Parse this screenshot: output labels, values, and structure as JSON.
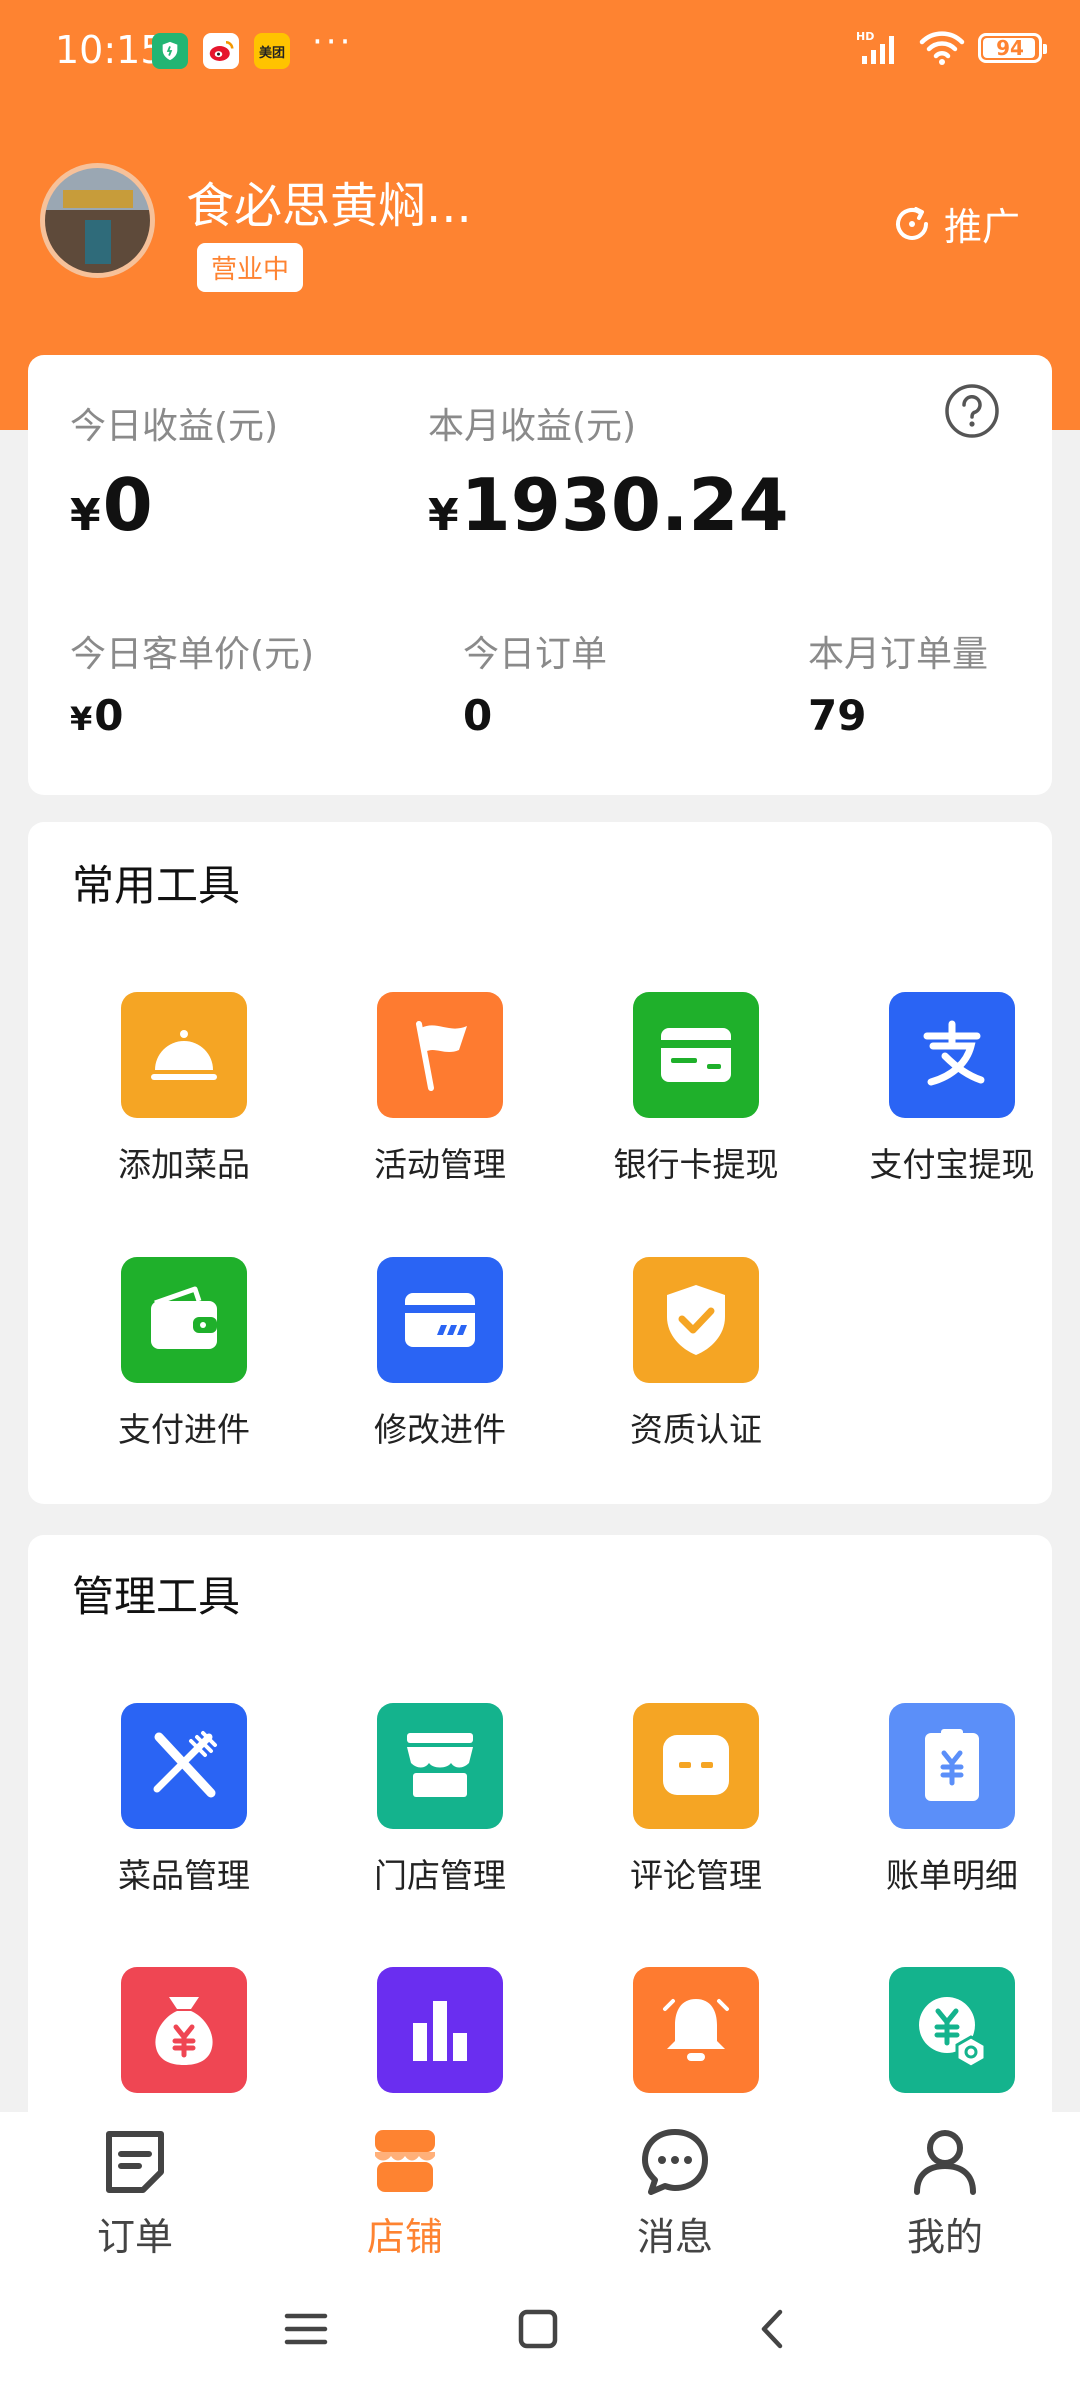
{
  "status_bar": {
    "time": "10:15",
    "app_icons": [
      {
        "name": "shield-app-icon",
        "text": "",
        "color": "#22b573"
      },
      {
        "name": "weibo-app-icon",
        "text": "",
        "color": "#e6162d"
      },
      {
        "name": "meituan-app-icon",
        "text": "美团",
        "color": "#ffc300"
      }
    ],
    "dots": "···",
    "battery": "94"
  },
  "header": {
    "shop_name": "食必思黄焖...",
    "status_badge": "营业中",
    "promo_label": "推广"
  },
  "earnings": {
    "today_label": "今日收益(元)",
    "today_currency": "¥",
    "today_value": "0",
    "month_label": "本月收益(元)",
    "month_currency": "¥",
    "month_value": "1930.24",
    "avg_label": "今日客单价(元)",
    "avg_currency": "¥",
    "avg_value": "0",
    "orders_today_label": "今日订单",
    "orders_today_value": "0",
    "orders_month_label": "本月订单量",
    "orders_month_value": "79"
  },
  "common_tools": {
    "title": "常用工具",
    "items": [
      {
        "label": "添加菜品",
        "icon": "dish-cover-icon",
        "color": "#f5a524"
      },
      {
        "label": "活动管理",
        "icon": "flag-icon",
        "color": "#fe7b30"
      },
      {
        "label": "银行卡提现",
        "icon": "bank-card-icon",
        "color": "#1fb02b"
      },
      {
        "label": "支付宝提现",
        "icon": "alipay-icon",
        "color": "#2a64f4"
      },
      {
        "label": "支付进件",
        "icon": "wallet-icon",
        "color": "#1fb02b"
      },
      {
        "label": "修改进件",
        "icon": "card-edit-icon",
        "color": "#2a64f4"
      },
      {
        "label": "资质认证",
        "icon": "shield-check-icon",
        "color": "#f5a524"
      }
    ]
  },
  "management_tools": {
    "title": "管理工具",
    "items": [
      {
        "label": "菜品管理",
        "icon": "fork-knife-icon",
        "color": "#2a64f4"
      },
      {
        "label": "门店管理",
        "icon": "storefront-icon",
        "color": "#14b38d"
      },
      {
        "label": "评论管理",
        "icon": "comment-icon",
        "color": "#f5a524"
      },
      {
        "label": "账单明细",
        "icon": "bill-icon",
        "color": "#5b8ff9"
      },
      {
        "label": "",
        "icon": "money-bag-icon",
        "color": "#ef4653"
      },
      {
        "label": "",
        "icon": "bar-chart-icon",
        "color": "#6a2ef0"
      },
      {
        "label": "",
        "icon": "bell-icon",
        "color": "#fe7b30"
      },
      {
        "label": "",
        "icon": "yen-badge-icon",
        "color": "#14b38d"
      }
    ]
  },
  "bottom_nav": [
    {
      "label": "订单",
      "icon": "order-icon",
      "active": false
    },
    {
      "label": "店铺",
      "icon": "shop-icon",
      "active": true
    },
    {
      "label": "消息",
      "icon": "message-icon",
      "active": false
    },
    {
      "label": "我的",
      "icon": "profile-icon",
      "active": false
    }
  ],
  "colors": {
    "accent": "#fe8331",
    "background": "#f1f1f1"
  }
}
